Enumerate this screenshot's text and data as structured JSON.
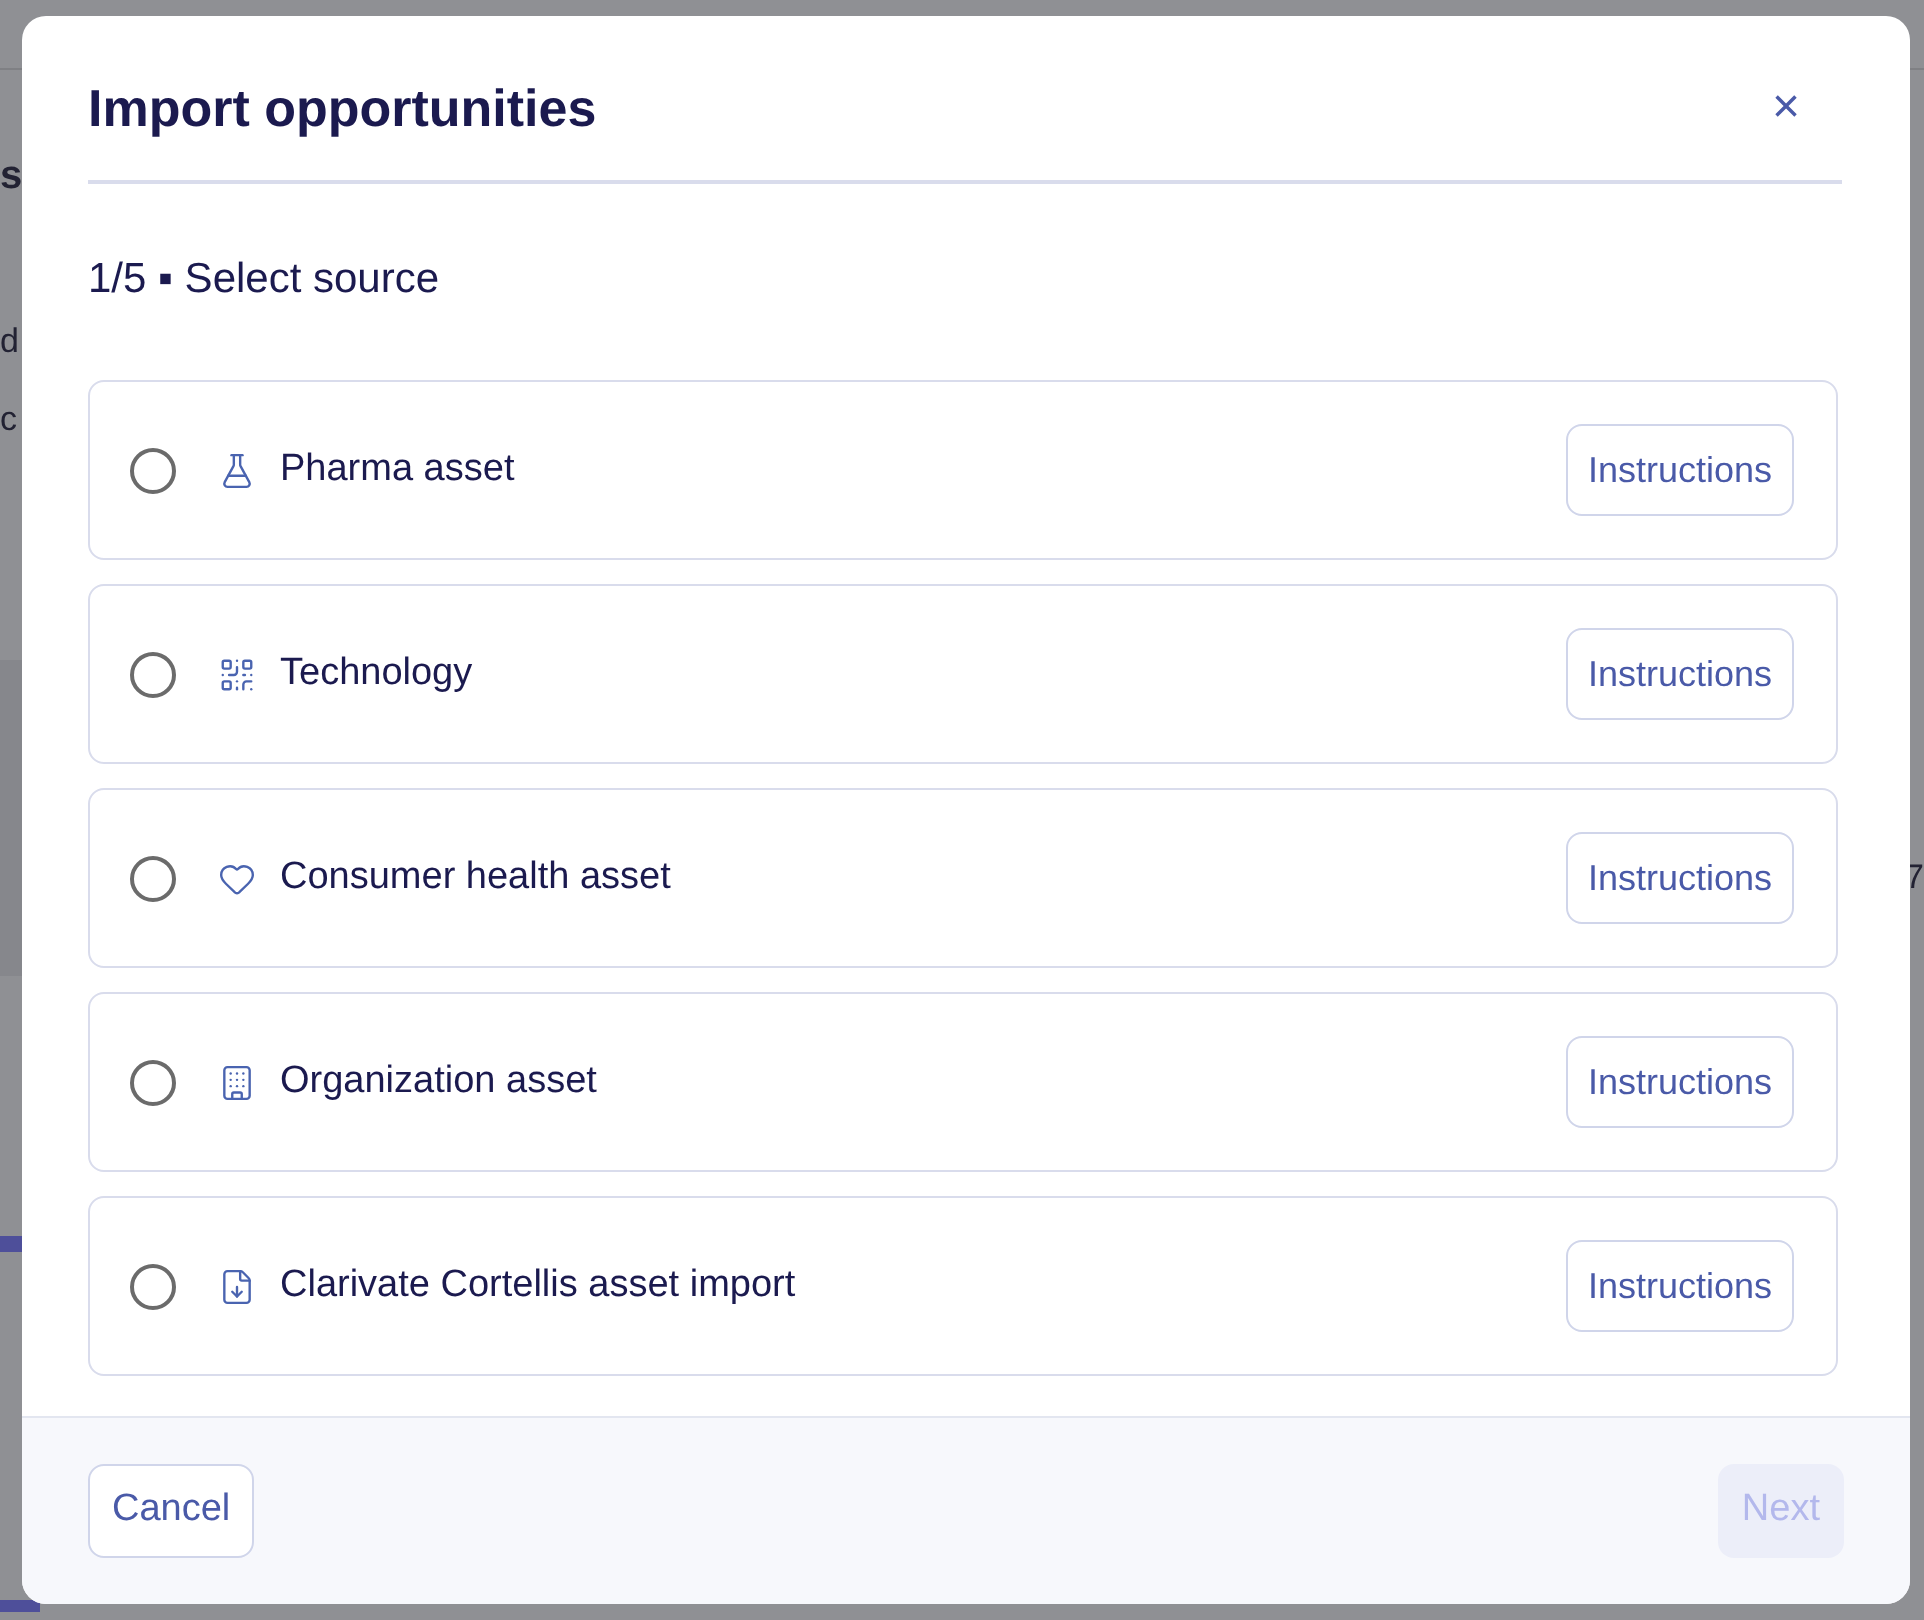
{
  "background": {
    "fragments": [
      {
        "text": "s"
      },
      {
        "text": "d"
      },
      {
        "text": "c"
      },
      {
        "text": "7"
      }
    ]
  },
  "dialog": {
    "title": "Import opportunities",
    "close": "×",
    "step": "1/5 ▪ Select source",
    "sources": [
      {
        "label": "Pharma asset",
        "kind": "flask",
        "selected": false,
        "action": "Instructions"
      },
      {
        "label": "Technology",
        "kind": "qr",
        "selected": false,
        "action": "Instructions"
      },
      {
        "label": "Consumer health asset",
        "kind": "heart",
        "selected": false,
        "action": "Instructions"
      },
      {
        "label": "Organization asset",
        "kind": "building",
        "selected": false,
        "action": "Instructions"
      },
      {
        "label": "Clarivate Cortellis asset import",
        "kind": "import",
        "selected": false,
        "action": "Instructions"
      }
    ],
    "footer": {
      "cancel": "Cancel",
      "next": {
        "label": "Next",
        "disabled": true
      }
    }
  }
}
